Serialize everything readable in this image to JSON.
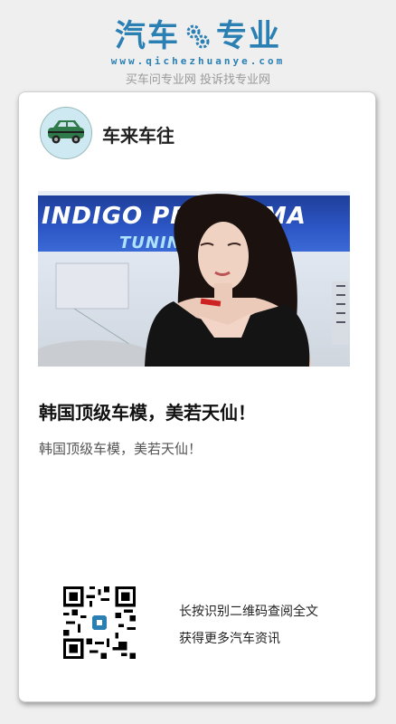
{
  "brand": {
    "logo_left": "汽车",
    "logo_right": "专业",
    "domain": "www.qichezhuanye.com",
    "tagline": "买车问专业网 投诉找专业网",
    "color": "#2a7fb3"
  },
  "post": {
    "author": "车来车往",
    "photo_banner_line1": "INDIGO PERFORMA",
    "photo_banner_line2": "TUNING PARTS",
    "title": "韩国顶级车模，美若天仙！",
    "description": "韩国顶级车模，美若天仙！"
  },
  "qr": {
    "line1": "长按识别二维码查阅全文",
    "line2": "获得更多汽车资讯"
  }
}
